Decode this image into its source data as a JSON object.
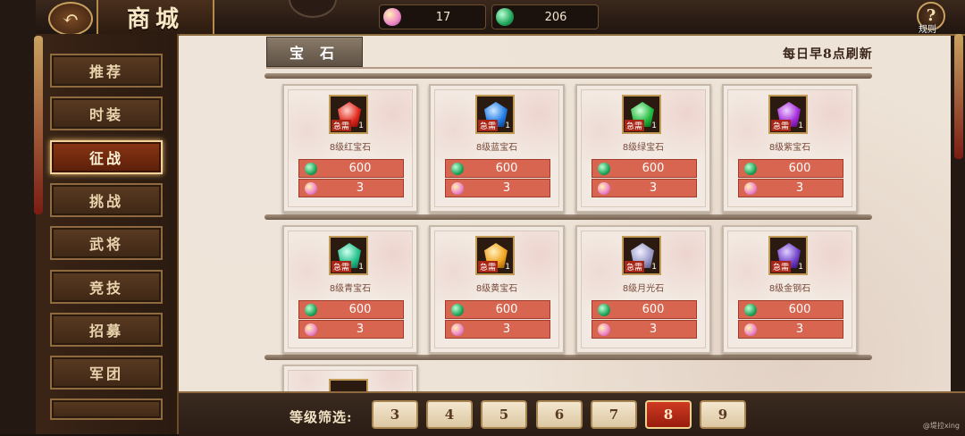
{
  "header": {
    "title": "商城",
    "currencies": [
      {
        "icon": "pink-gem-icon",
        "value": "17"
      },
      {
        "icon": "green-jade-icon",
        "value": "206"
      }
    ],
    "rules_label": "规则"
  },
  "sidebar": {
    "items": [
      {
        "label": "推荐",
        "active": false
      },
      {
        "label": "时装",
        "active": false
      },
      {
        "label": "征战",
        "active": true
      },
      {
        "label": "挑战",
        "active": false
      },
      {
        "label": "武将",
        "active": false
      },
      {
        "label": "竞技",
        "active": false
      },
      {
        "label": "招募",
        "active": false
      },
      {
        "label": "军团",
        "active": false
      }
    ]
  },
  "shop": {
    "tab_label": "宝石",
    "refresh_note": "每日早8点刷新",
    "items": [
      {
        "name": "8级红宝石",
        "badge": "急需",
        "count": "1",
        "color": "#e0261c",
        "price_jade": "600",
        "price_gem": "3"
      },
      {
        "name": "8级蓝宝石",
        "badge": "急需",
        "count": "1",
        "color": "#1e7be6",
        "price_jade": "600",
        "price_gem": "3"
      },
      {
        "name": "8级绿宝石",
        "badge": "急需",
        "count": "1",
        "color": "#1eb83c",
        "price_jade": "600",
        "price_gem": "3"
      },
      {
        "name": "8级紫宝石",
        "badge": "急需",
        "count": "1",
        "color": "#a22ad8",
        "price_jade": "600",
        "price_gem": "3"
      },
      {
        "name": "8级青宝石",
        "badge": "急需",
        "count": "1",
        "color": "#22c08a",
        "price_jade": "600",
        "price_gem": "3"
      },
      {
        "name": "8级黄宝石",
        "badge": "急需",
        "count": "1",
        "color": "#f0a21c",
        "price_jade": "600",
        "price_gem": "3"
      },
      {
        "name": "8级月光石",
        "badge": "急需",
        "count": "1",
        "color": "#9a9ac8",
        "price_jade": "600",
        "price_gem": "3"
      },
      {
        "name": "8级金钢石",
        "badge": "急需",
        "count": "1",
        "color": "#7040c8",
        "price_jade": "600",
        "price_gem": "3"
      }
    ]
  },
  "filter": {
    "label": "等级筛选:",
    "levels": [
      "3",
      "4",
      "5",
      "6",
      "7",
      "8",
      "9"
    ],
    "selected": "8"
  },
  "watermark": "@堤拉xing"
}
